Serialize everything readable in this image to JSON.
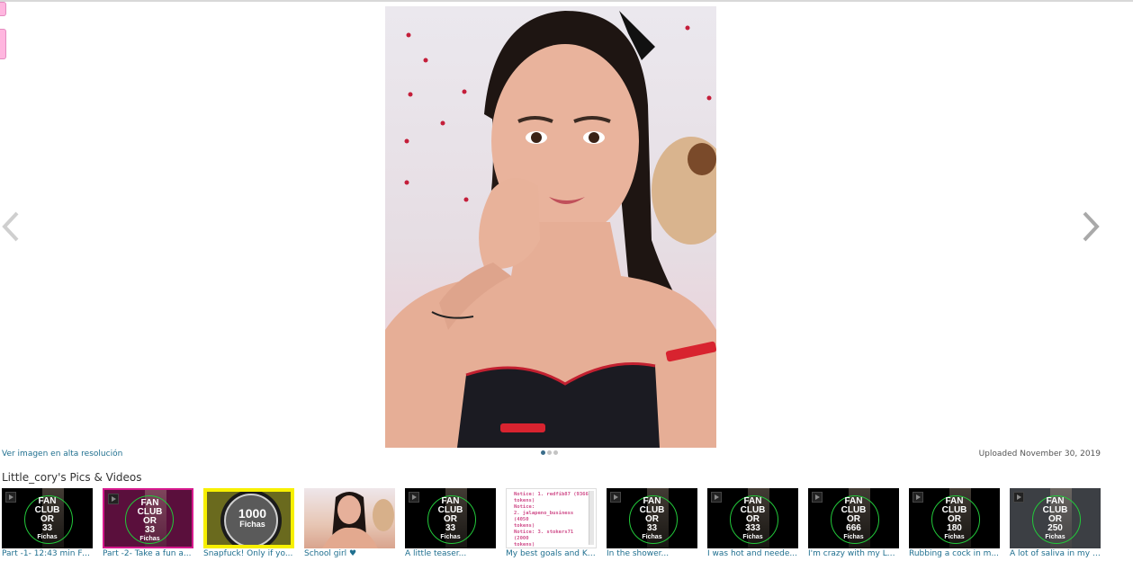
{
  "main_photo": {
    "alt": "Little_cory photo"
  },
  "hires_link": "Ver imagen en alta resolución",
  "upload_date": "Uploaded November 30, 2019",
  "section_title": "Little_cory's Pics & Videos",
  "colors": {
    "link": "#1f6f8f",
    "badge_ring": "#22c83a",
    "pink_tab": "#ffb6df",
    "yellow_frame": "#f7f000",
    "magenta_frame": "#d6198d"
  },
  "thumbs": [
    {
      "type": "fanclub",
      "caption": "Part -1- 12:43 min Fu...",
      "line1": "FAN",
      "line2": "CLUB",
      "line3": "OR",
      "amount": "33",
      "unit": "Fichas"
    },
    {
      "type": "fanclub",
      "caption": "Part -2- Take a fun a...",
      "line1": "FAN",
      "line2": "CLUB",
      "line3": "OR",
      "amount": "33",
      "unit": "Fichas"
    },
    {
      "type": "fichas",
      "caption": "Snapfuck! Only if yo...",
      "amount": "1000",
      "unit": "Fichas"
    },
    {
      "type": "photo",
      "caption": "School girl ♥"
    },
    {
      "type": "fanclub",
      "caption": "A little teaser...",
      "line1": "FAN",
      "line2": "CLUB",
      "line3": "OR",
      "amount": "33",
      "unit": "Fichas"
    },
    {
      "type": "notice",
      "caption": "My best goals and Ki...",
      "notice": [
        "Notice: 1. redfib87 (9366",
        "tokens)",
        "Notice:",
        "2. jalapeno_business (4050",
        "tokens)",
        "Notice: 3. stokers71 (2000",
        "tokens)",
        "Notice:"
      ]
    },
    {
      "type": "fanclub",
      "caption": "In the shower...",
      "line1": "FAN",
      "line2": "CLUB",
      "line3": "OR",
      "amount": "33",
      "unit": "Fichas"
    },
    {
      "type": "fanclub",
      "caption": "I was hot and neede...",
      "line1": "FAN",
      "line2": "CLUB",
      "line3": "OR",
      "amount": "333",
      "unit": "Fichas"
    },
    {
      "type": "fanclub",
      "caption": "I'm crazy with my Lo...",
      "line1": "FAN",
      "line2": "CLUB",
      "line3": "OR",
      "amount": "666",
      "unit": "Fichas"
    },
    {
      "type": "fanclub",
      "caption": "Rubbing a cock in m...",
      "line1": "FAN",
      "line2": "CLUB",
      "line3": "OR",
      "amount": "180",
      "unit": "Fichas"
    },
    {
      "type": "fanclub",
      "caption": "A lot of saliva in my f...",
      "line1": "FAN",
      "line2": "CLUB",
      "line3": "OR",
      "amount": "250",
      "unit": "Fichas"
    }
  ]
}
